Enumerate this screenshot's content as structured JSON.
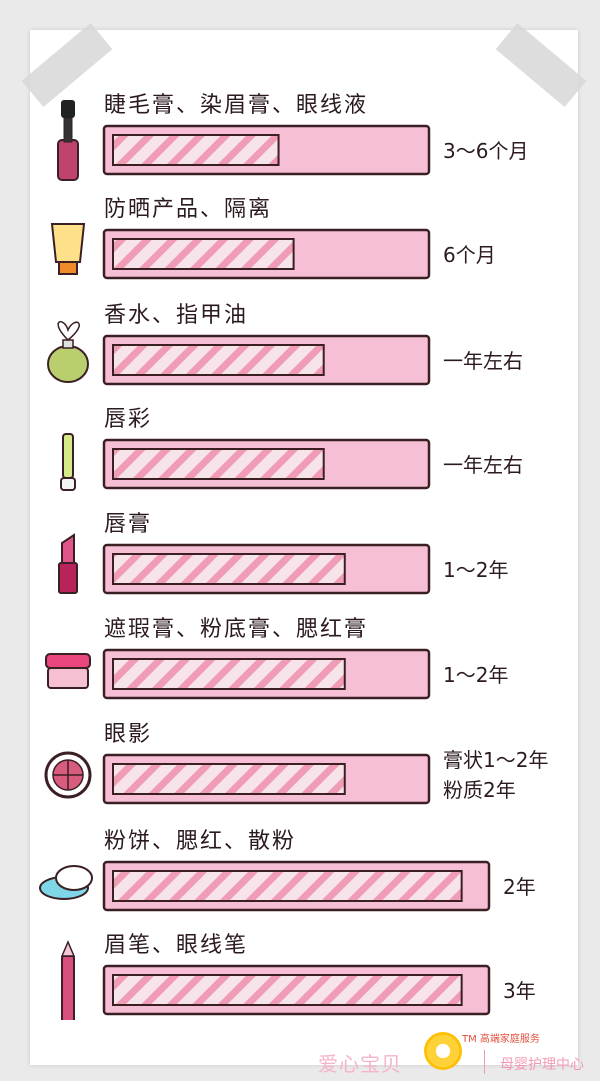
{
  "chart_data": {
    "type": "bar",
    "orientation": "horizontal",
    "colors": {
      "bar_outer": "#f6bfd6",
      "bar_outline": "#3a1f23",
      "inner_fill": "#f3dce4",
      "hatch": "#f08aa8",
      "text": "#2b1a1e"
    },
    "rows": [
      {
        "category": "睫毛膏、染眉膏、眼线液",
        "label": "3～6个月",
        "lines": [
          "3～6个月"
        ],
        "value": 0.55,
        "icon": "mascara-icon"
      },
      {
        "category": "防晒产品、隔离",
        "label": "6个月",
        "lines": [
          "6个月"
        ],
        "value": 0.6,
        "icon": "sunscreen-tube-icon"
      },
      {
        "category": "香水、指甲油",
        "label": "一年左右",
        "lines": [
          "一年左右"
        ],
        "value": 0.7,
        "icon": "perfume-bottle-icon"
      },
      {
        "category": "唇彩",
        "label": "一年左右",
        "lines": [
          "一年左右"
        ],
        "value": 0.7,
        "icon": "lip-gloss-icon"
      },
      {
        "category": "唇膏",
        "label": "1～2年",
        "lines": [
          "1～2年"
        ],
        "value": 0.77,
        "icon": "lipstick-icon"
      },
      {
        "category": "遮瑕膏、粉底膏、腮红膏",
        "label": "1～2年",
        "lines": [
          "1～2年"
        ],
        "value": 0.77,
        "icon": "cream-jar-icon"
      },
      {
        "category": "眼影",
        "label": "膏状1～2年 粉质2年",
        "lines": [
          "膏状1～2年",
          "粉质2年"
        ],
        "value": 0.77,
        "icon": "eyeshadow-compact-icon"
      },
      {
        "category": "粉饼、腮红、散粉",
        "label": "2年",
        "lines": [
          "2年"
        ],
        "value": 0.95,
        "icon": "powder-puff-icon"
      },
      {
        "category": "眉笔、眼线笔",
        "label": "3年",
        "lines": [
          "3年"
        ],
        "value": 0.95,
        "icon": "eyebrow-pencil-icon"
      }
    ]
  },
  "footer": {
    "brand": "爱心宝贝",
    "tm_line": "TM 高端家庭服务",
    "sub": "母婴护理中心"
  }
}
